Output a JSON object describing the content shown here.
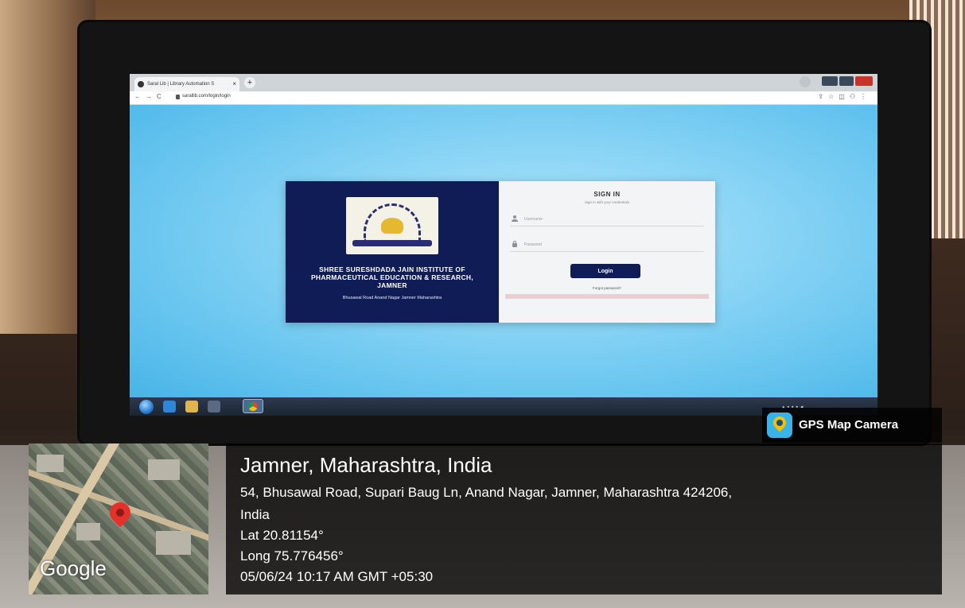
{
  "browser": {
    "tab_title": "Saral Lib | Library Automation S",
    "tab_close": "×",
    "new_tab": "+",
    "url": "sarallib.com/login/login"
  },
  "card": {
    "institute_name": "SHREE SURESHDADA JAIN INSTITUTE OF PHARMACEUTICAL EDUCATION & RESEARCH, JAMNER",
    "institute_address": "Bhusawal Road Anand Nagar Jamner Maharashtra",
    "signin_title": "SIGN IN",
    "signin_subtitle": "Sign in with your credentials",
    "username_placeholder": "Username",
    "password_placeholder": "Password",
    "login_label": "Login",
    "forgot_label": "Forgot password?"
  },
  "gps": {
    "app_name": "GPS Map Camera",
    "map_label": "Google",
    "place_title": "Jamner, Maharashtra, India",
    "address_line1": "54, Bhusawal Road, Supari Baug Ln, Anand Nagar, Jamner, Maharashtra 424206,",
    "address_line2": "India",
    "latitude": "Lat 20.81154°",
    "longitude": "Long 75.776456°",
    "datetime": "05/06/24 10:17 AM GMT +05:30"
  },
  "colors": {
    "card_navy": "#0f1c56",
    "page_blue": "#8ed6f6",
    "pin_red": "#e3322b"
  },
  "icons": [
    "user-icon",
    "lock-icon",
    "map-pin-icon",
    "gps-camera-icon",
    "windows-start-icon",
    "chrome-icon"
  ]
}
